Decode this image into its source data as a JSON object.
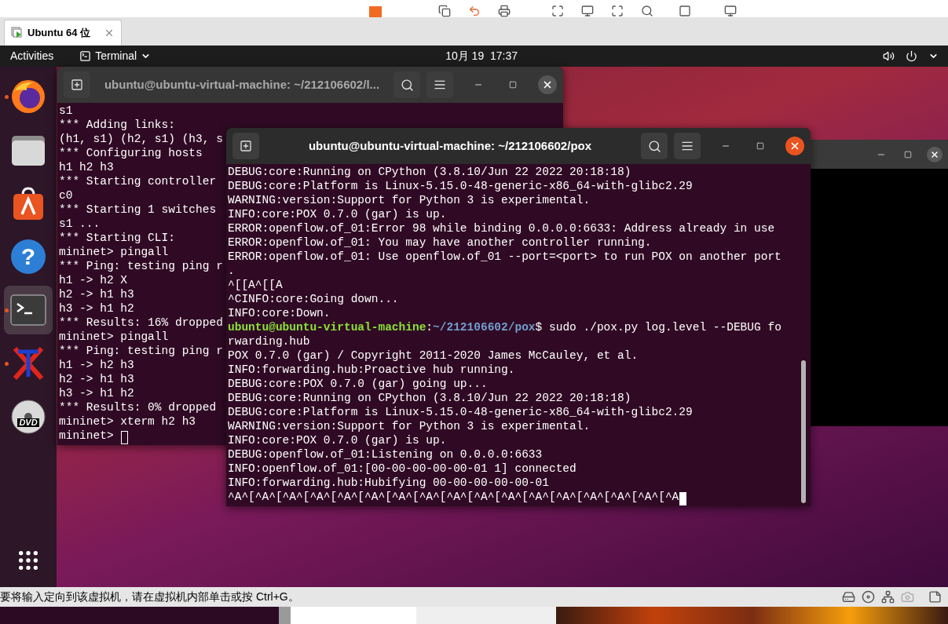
{
  "vm_tab": {
    "title": "Ubuntu 64 位",
    "selected": true
  },
  "top_bar": {
    "activities": "Activities",
    "app_menu": "Terminal",
    "clock": "10月 19  17:37"
  },
  "dock": {
    "items": [
      {
        "kind": "firefox",
        "running": true,
        "selected": false
      },
      {
        "kind": "files",
        "running": false,
        "selected": false
      },
      {
        "kind": "software",
        "running": false,
        "selected": false
      },
      {
        "kind": "help",
        "glyph": "?",
        "running": false,
        "selected": false
      },
      {
        "kind": "terminal",
        "running": true,
        "selected": true
      },
      {
        "kind": "xterm",
        "running": true,
        "selected": false
      },
      {
        "kind": "dvd",
        "glyph": "DVD",
        "running": false,
        "selected": false
      }
    ]
  },
  "terminals": [
    {
      "title": "ubuntu@ubuntu-virtual-machine: ~/212106602/l...",
      "active": false,
      "lines": [
        {
          "kind": "output",
          "text": "s1"
        },
        {
          "kind": "output",
          "text": "*** Adding links:"
        },
        {
          "kind": "output",
          "text": "(h1, s1) (h2, s1) (h3, s"
        },
        {
          "kind": "output",
          "text": "*** Configuring hosts"
        },
        {
          "kind": "output",
          "text": "h1 h2 h3"
        },
        {
          "kind": "output",
          "text": "*** Starting controller"
        },
        {
          "kind": "output",
          "text": "c0"
        },
        {
          "kind": "output",
          "text": "*** Starting 1 switches"
        },
        {
          "kind": "output",
          "text": "s1 ..."
        },
        {
          "kind": "output",
          "text": "*** Starting CLI:"
        },
        {
          "kind": "output",
          "text": "mininet> pingall"
        },
        {
          "kind": "output",
          "text": "*** Ping: testing ping r"
        },
        {
          "kind": "output",
          "text": "h1 -> h2 X"
        },
        {
          "kind": "output",
          "text": "h2 -> h1 h3"
        },
        {
          "kind": "output",
          "text": "h3 -> h1 h2"
        },
        {
          "kind": "output",
          "text": "*** Results: 16% dropped"
        },
        {
          "kind": "output",
          "text": "mininet> pingall"
        },
        {
          "kind": "output",
          "text": "*** Ping: testing ping r"
        },
        {
          "kind": "output",
          "text": "h1 -> h2 h3"
        },
        {
          "kind": "output",
          "text": "h2 -> h1 h3"
        },
        {
          "kind": "output",
          "text": "h3 -> h1 h2"
        },
        {
          "kind": "output",
          "text": "*** Results: 0% dropped"
        },
        {
          "kind": "output",
          "text": "mininet> xterm h2 h3"
        },
        {
          "kind": "output",
          "text": "mininet>",
          "cursor": true
        }
      ]
    },
    {
      "title": "ubuntu@ubuntu-virtual-machine: ~/212106602/pox",
      "active": true,
      "lines": [
        {
          "kind": "output",
          "text": "DEBUG:core:Running on CPython (3.8.10/Jun 22 2022 20:18:18)"
        },
        {
          "kind": "output",
          "text": "DEBUG:core:Platform is Linux-5.15.0-48-generic-x86_64-with-glibc2.29"
        },
        {
          "kind": "output",
          "text": "WARNING:version:Support for Python 3 is experimental."
        },
        {
          "kind": "output",
          "text": "INFO:core:POX 0.7.0 (gar) is up."
        },
        {
          "kind": "output",
          "text": "ERROR:openflow.of_01:Error 98 while binding 0.0.0.0:6633: Address already in use"
        },
        {
          "kind": "output",
          "text": "ERROR:openflow.of_01: You may have another controller running."
        },
        {
          "kind": "output",
          "text": "ERROR:openflow.of_01: Use openflow.of_01 --port=<port> to run POX on another port"
        },
        {
          "kind": "output",
          "text": "."
        },
        {
          "kind": "output",
          "text": "^[[A^[[A"
        },
        {
          "kind": "output",
          "text": "^CINFO:core:Going down..."
        },
        {
          "kind": "output",
          "text": "INFO:core:Down."
        },
        {
          "kind": "prompt",
          "user": "ubuntu@ubuntu-virtual-machine",
          "separator": ":",
          "path": "~/212106602/pox",
          "command": "$ sudo ./pox.py log.level --DEBUG fo"
        },
        {
          "kind": "output",
          "text": "rwarding.hub"
        },
        {
          "kind": "output",
          "text": "POX 0.7.0 (gar) / Copyright 2011-2020 James McCauley, et al."
        },
        {
          "kind": "output",
          "text": "INFO:forwarding.hub:Proactive hub running."
        },
        {
          "kind": "output",
          "text": "DEBUG:core:POX 0.7.0 (gar) going up..."
        },
        {
          "kind": "output",
          "text": "DEBUG:core:Running on CPython (3.8.10/Jun 22 2022 20:18:18)"
        },
        {
          "kind": "output",
          "text": "DEBUG:core:Platform is Linux-5.15.0-48-generic-x86_64-with-glibc2.29"
        },
        {
          "kind": "output",
          "text": "WARNING:version:Support for Python 3 is experimental."
        },
        {
          "kind": "output",
          "text": "INFO:core:POX 0.7.0 (gar) is up."
        },
        {
          "kind": "output",
          "text": "DEBUG:openflow.of_01:Listening on 0.0.0.0:6633"
        },
        {
          "kind": "output",
          "text": "INFO:openflow.of_01:[00-00-00-00-00-01 1] connected"
        },
        {
          "kind": "output",
          "text": "INFO:forwarding.hub:Hubifying 00-00-00-00-00-01"
        },
        {
          "kind": "output",
          "text": "^A^[^A^[^A^[^A^[^A^[^A^[^A^[^A^[^A^[^A^[^A^[^A^[^A^[^A^[^A^[^A^[^A",
          "cursor": true
        }
      ]
    }
  ],
  "status_bar": {
    "message": "要将输入定向到该虚拟机，请在虚拟机内部单击或按 Ctrl+G。"
  }
}
